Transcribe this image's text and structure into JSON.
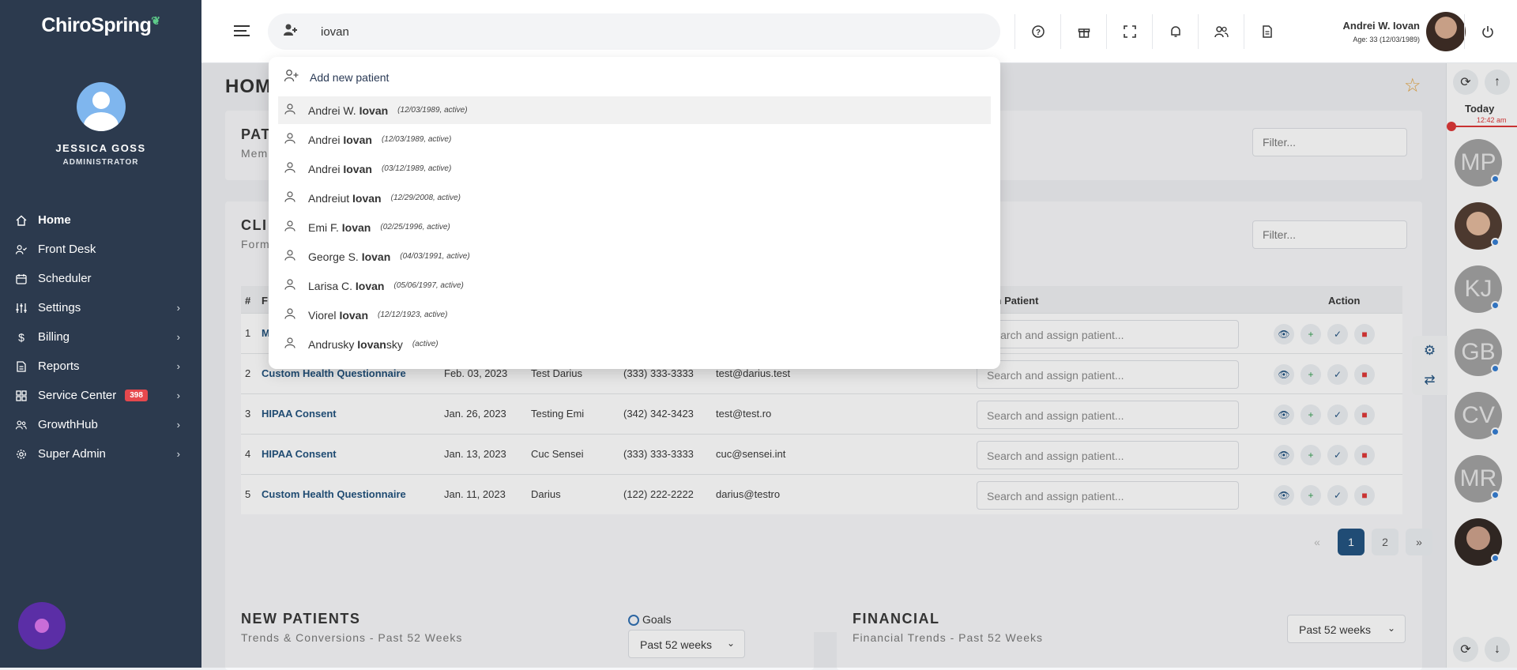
{
  "sidebar": {
    "logo": "ChiroSpring",
    "user_name": "JESSICA GOSS",
    "user_role": "ADMINISTRATOR",
    "items": [
      {
        "label": "Home",
        "icon": "home-icon",
        "active": true,
        "chevron": false
      },
      {
        "label": "Front Desk",
        "icon": "user-check-icon",
        "chevron": false
      },
      {
        "label": "Scheduler",
        "icon": "calendar-icon",
        "chevron": false
      },
      {
        "label": "Settings",
        "icon": "sliders-icon",
        "chevron": true
      },
      {
        "label": "Billing",
        "icon": "dollar-icon",
        "chevron": true
      },
      {
        "label": "Reports",
        "icon": "document-icon",
        "chevron": true
      },
      {
        "label": "Service Center",
        "icon": "grid-icon",
        "chevron": true,
        "badge": "398"
      },
      {
        "label": "GrowthHub",
        "icon": "users-icon",
        "chevron": true
      },
      {
        "label": "Super Admin",
        "icon": "gear-icon",
        "chevron": true
      }
    ]
  },
  "topbar": {
    "search_value": "iovan",
    "profile_name": "Andrei W. Iovan",
    "profile_age": "Age: 33 (12/03/1989)"
  },
  "search_dropdown": {
    "add_label": "Add new patient",
    "results": [
      {
        "prefix": "Andrei W. ",
        "match": "Iovan",
        "suffix": "",
        "meta": "(12/03/1989, active)"
      },
      {
        "prefix": "Andrei ",
        "match": "Iovan",
        "suffix": "",
        "meta": "(12/03/1989, active)"
      },
      {
        "prefix": "Andrei ",
        "match": "Iovan",
        "suffix": "",
        "meta": "(03/12/1989, active)"
      },
      {
        "prefix": "Andreiut ",
        "match": "Iovan",
        "suffix": "",
        "meta": "(12/29/2008, active)"
      },
      {
        "prefix": "Emi F. ",
        "match": "Iovan",
        "suffix": "",
        "meta": "(02/25/1996, active)"
      },
      {
        "prefix": "George S. ",
        "match": "Iovan",
        "suffix": "",
        "meta": "(04/03/1991, active)"
      },
      {
        "prefix": "Larisa C. ",
        "match": "Iovan",
        "suffix": "",
        "meta": "(05/06/1997, active)"
      },
      {
        "prefix": "Viorel ",
        "match": "Iovan",
        "suffix": "",
        "meta": "(12/12/1923, active)"
      },
      {
        "prefix": "Andrusky ",
        "match": "Iovan",
        "suffix": "sky",
        "meta": "(active)"
      }
    ]
  },
  "main": {
    "page_title": "HOM",
    "patients_card": {
      "title": "PAT",
      "subtitle": "Mem",
      "filter_placeholder": "Filter..."
    },
    "clinic_card": {
      "title": "CLI",
      "subtitle": "Form",
      "filter_placeholder": "Filter...",
      "headers": {
        "num": "#",
        "form": "F",
        "search_patient": "arch Patient",
        "action": "Action"
      },
      "select_placeholder": "Search and assign patient...",
      "rows": [
        {
          "num": "1",
          "form": "M",
          "date": "",
          "name": "",
          "phone": "",
          "email": ""
        },
        {
          "num": "2",
          "form": "Custom Health Questionnaire",
          "date": "Feb. 03, 2023",
          "name": "Test Darius",
          "phone": "(333) 333-3333",
          "email": "test@darius.test"
        },
        {
          "num": "3",
          "form": "HIPAA Consent",
          "date": "Jan. 26, 2023",
          "name": "Testing Emi",
          "phone": "(342) 342-3423",
          "email": "test@test.ro"
        },
        {
          "num": "4",
          "form": "HIPAA Consent",
          "date": "Jan. 13, 2023",
          "name": "Cuc Sensei",
          "phone": "(333) 333-3333",
          "email": "cuc@sensei.int"
        },
        {
          "num": "5",
          "form": "Custom Health Questionnaire",
          "date": "Jan. 11, 2023",
          "name": "Darius",
          "phone": "(122) 222-2222",
          "email": "darius@testro"
        }
      ],
      "pager": {
        "prev": "«",
        "pages": [
          "1",
          "2"
        ],
        "next": "»",
        "current": "1"
      }
    },
    "new_patients": {
      "title": "NEW PATIENTS",
      "subtitle": "Trends & Conversions - Past 52 Weeks",
      "goals_label": "Goals",
      "range": "Past 52 weeks"
    },
    "financial": {
      "title": "FINANCIAL",
      "subtitle": "Financial Trends - Past 52 Weeks",
      "range": "Past 52 weeks"
    }
  },
  "rightbar": {
    "today_label": "Today",
    "time": "12:42 am",
    "avatars": [
      "MP",
      "",
      "KJ",
      "GB",
      "CV",
      "MR",
      ""
    ]
  }
}
